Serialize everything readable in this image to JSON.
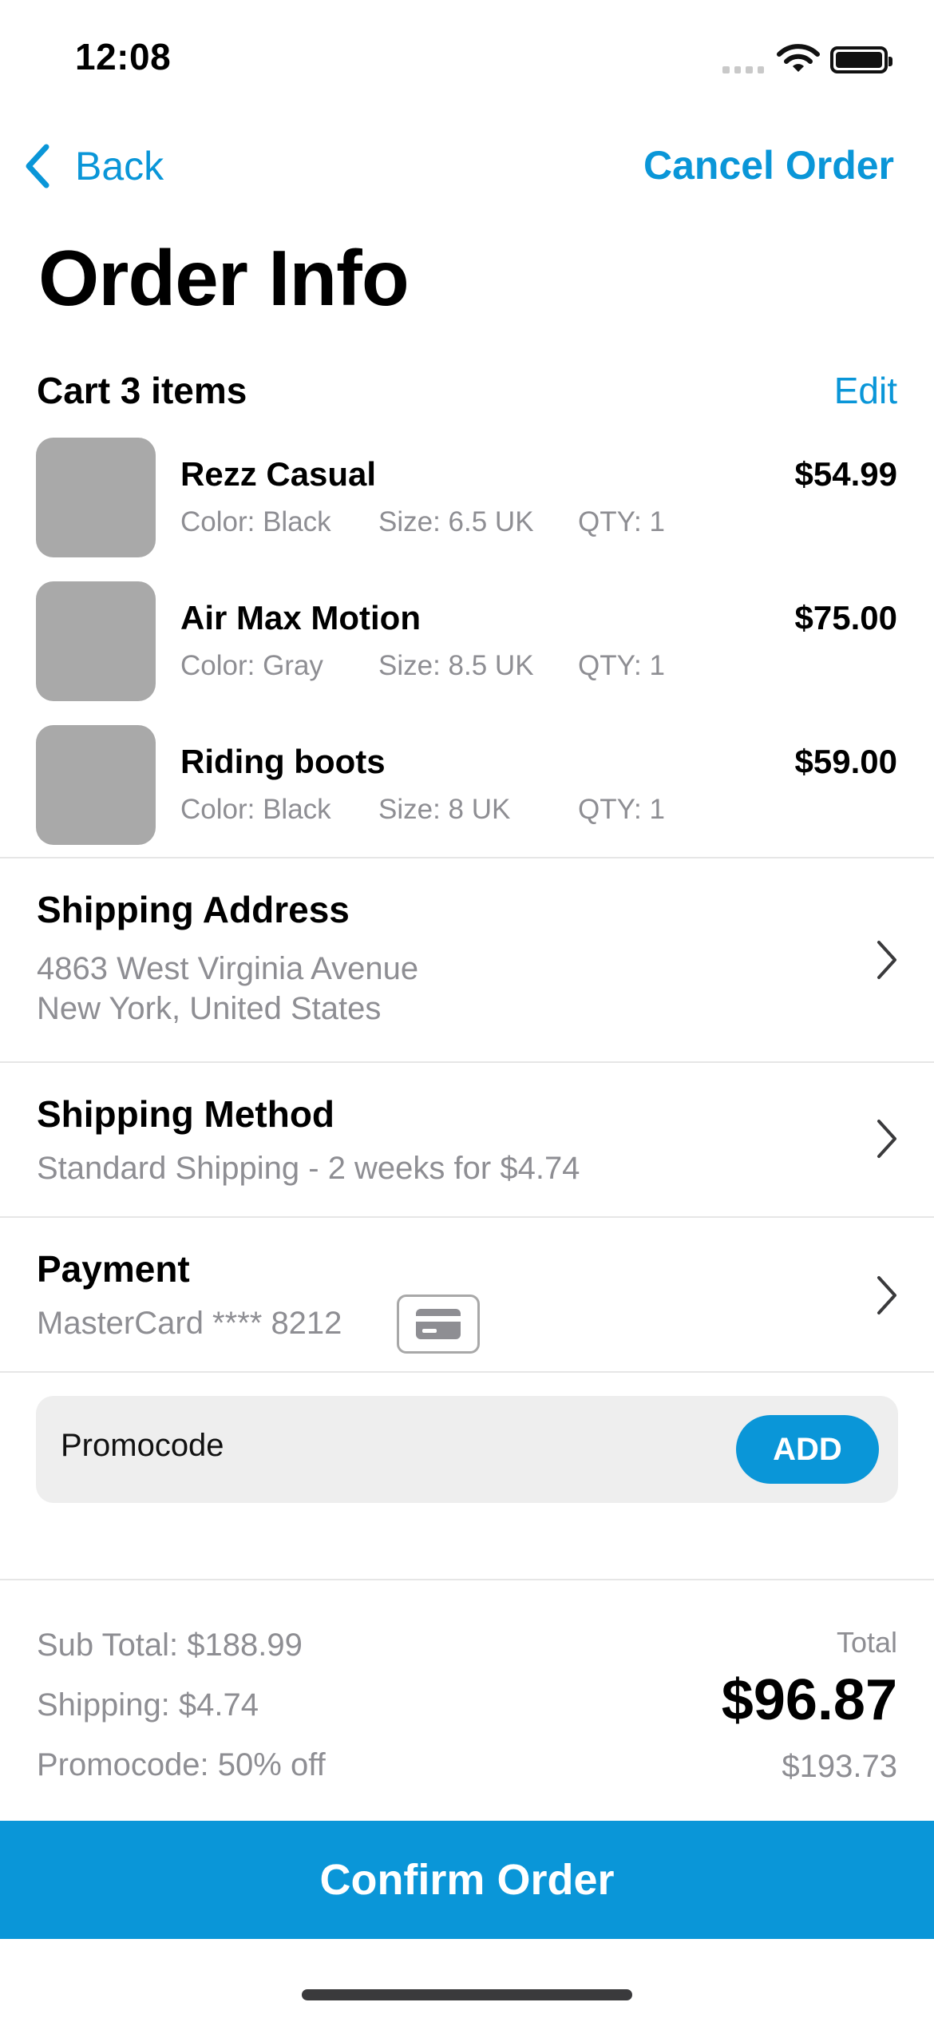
{
  "status_bar": {
    "time": "12:08"
  },
  "nav": {
    "back_label": "Back",
    "cancel_label": "Cancel Order"
  },
  "page": {
    "title": "Order Info"
  },
  "cart": {
    "title": "Cart 3 items",
    "edit_label": "Edit",
    "items": [
      {
        "name": "Rezz Casual",
        "price": "$54.99",
        "color": "Color: Black",
        "size": "Size: 6.5 UK",
        "qty": "QTY: 1"
      },
      {
        "name": "Air Max Motion",
        "price": "$75.00",
        "color": "Color: Gray",
        "size": "Size: 8.5 UK",
        "qty": "QTY: 1"
      },
      {
        "name": "Riding boots",
        "price": "$59.00",
        "color": "Color: Black",
        "size": "Size: 8 UK",
        "qty": "QTY: 1"
      }
    ]
  },
  "shipping_address": {
    "title": "Shipping Address",
    "line1": "4863  West Virginia Avenue",
    "line2": "New York, United States"
  },
  "shipping_method": {
    "title": "Shipping Method",
    "detail": "Standard Shipping - 2 weeks for $4.74"
  },
  "payment": {
    "title": "Payment",
    "detail": "MasterCard **** 8212",
    "icon": "credit-card-icon"
  },
  "promo": {
    "placeholder": "Promocode",
    "add_label": "ADD"
  },
  "summary": {
    "subtotal": "Sub Total: $188.99",
    "shipping": "Shipping: $4.74",
    "promocode": "Promocode: 50% off",
    "total_label": "Total",
    "total_value": "$96.87",
    "original_total": "$193.73"
  },
  "confirm_label": "Confirm Order",
  "colors": {
    "accent": "#0a96d8",
    "secondary_text": "#8e8e93",
    "thumbnail": "#a9a9a9"
  }
}
